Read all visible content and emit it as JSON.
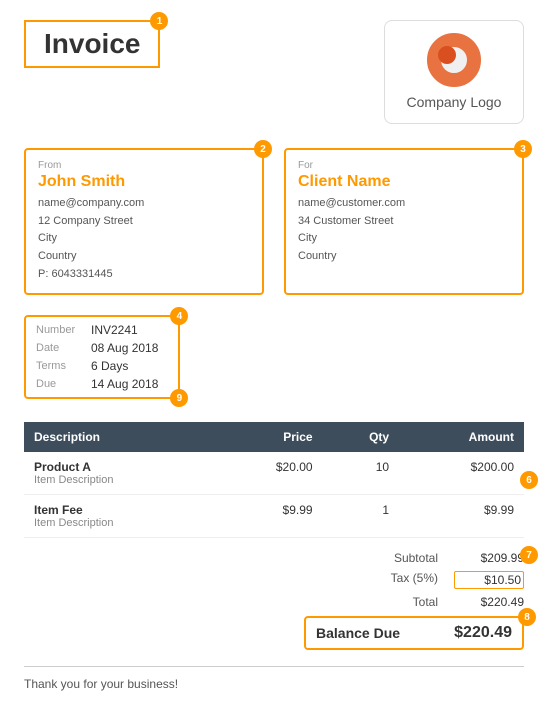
{
  "header": {
    "title": "Invoice",
    "badge": "1"
  },
  "logo": {
    "text": "Company Logo",
    "badge": null
  },
  "from": {
    "label": "From",
    "name": "John Smith",
    "email": "name@company.com",
    "address1": "12 Company Street",
    "address2": "City",
    "address3": "Country",
    "phone": "P: 6043331445",
    "badge": "2"
  },
  "for": {
    "label": "For",
    "name": "Client Name",
    "email": "name@customer.com",
    "address1": "34 Customer Street",
    "address2": "City",
    "address3": "Country",
    "badge": "3"
  },
  "meta": {
    "badge": "4",
    "badge9": "9",
    "fields": [
      {
        "label": "Number",
        "value": "INV2241"
      },
      {
        "label": "Date",
        "value": "08 Aug 2018"
      },
      {
        "label": "Terms",
        "value": "6 Days"
      },
      {
        "label": "Due",
        "value": "14 Aug 2018"
      }
    ]
  },
  "table": {
    "headers": [
      "Description",
      "Price",
      "Qty",
      "Amount"
    ],
    "badge": "6",
    "rows": [
      {
        "name": "Product A",
        "desc": "Item Description",
        "price": "$20.00",
        "qty": "10",
        "amount": "$200.00"
      },
      {
        "name": "Item Fee",
        "desc": "Item Description",
        "price": "$9.99",
        "qty": "1",
        "amount": "$9.99"
      }
    ]
  },
  "totals": {
    "badge7": "7",
    "badge8": "8",
    "subtotal_label": "Subtotal",
    "subtotal_value": "$209.99",
    "tax_label": "Tax (5%)",
    "tax_value": "$10.50",
    "total_label": "Total",
    "total_value": "$220.49",
    "balance_due_label": "Balance Due",
    "balance_due_value": "$220.49"
  },
  "footer": {
    "text": "Thank you for your business!"
  }
}
